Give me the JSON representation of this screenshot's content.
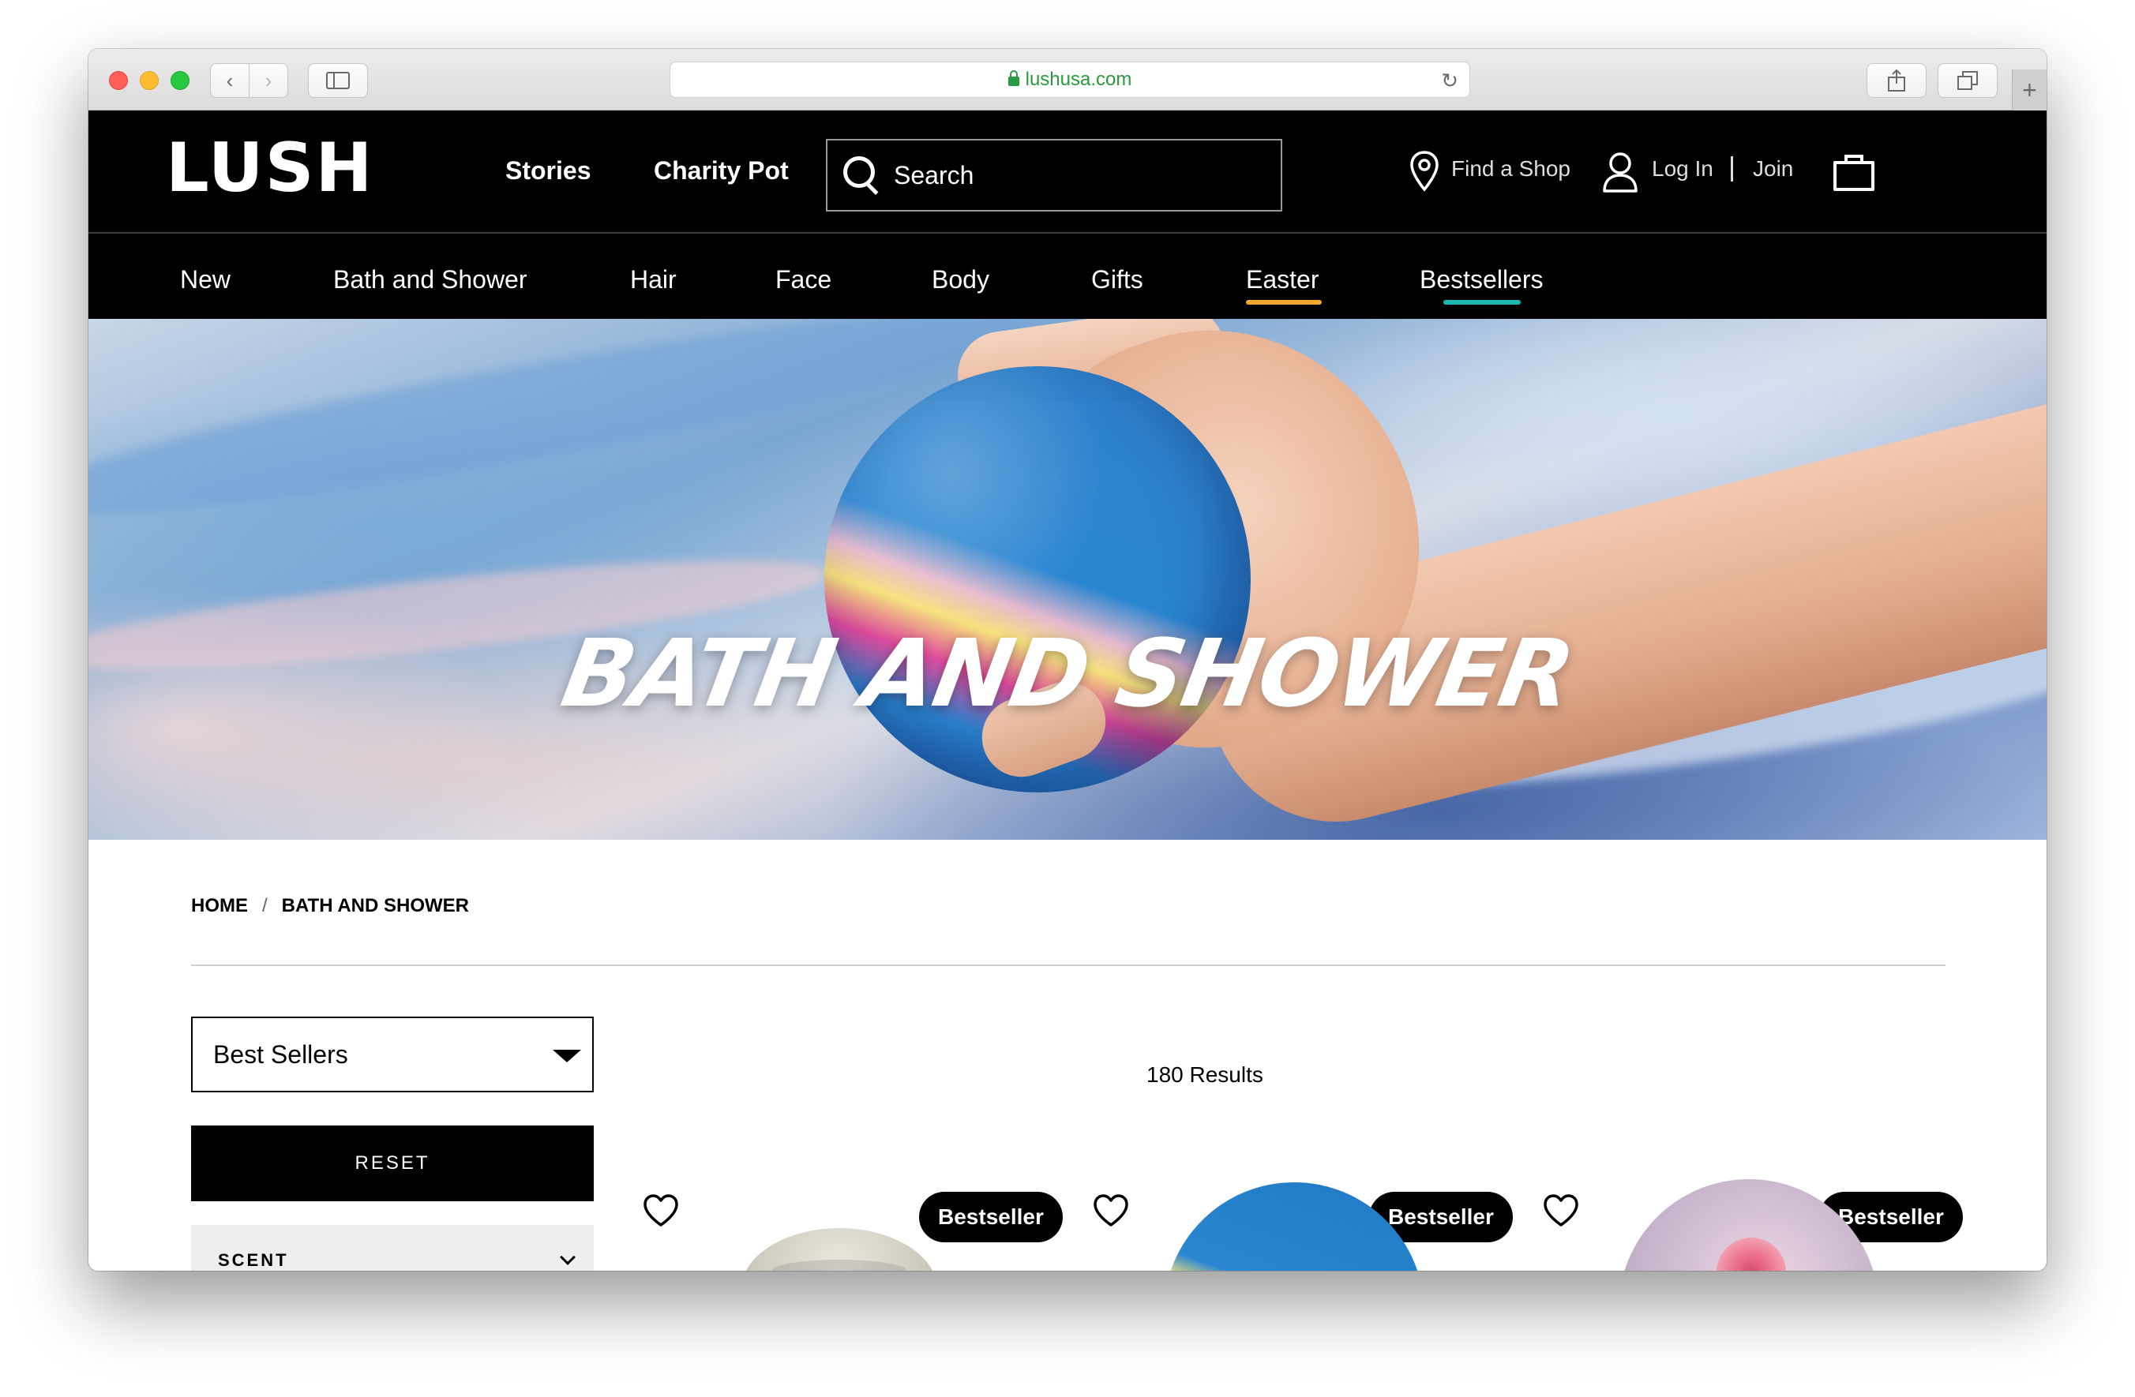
{
  "browser": {
    "url": "lushusa.com",
    "new_tab_symbol": "+"
  },
  "header": {
    "logo": "LUSH",
    "links": [
      "Stories",
      "Charity Pot"
    ],
    "search_placeholder": "Search",
    "find_shop": "Find a Shop",
    "log_in": "Log In",
    "join": "Join"
  },
  "category_nav": {
    "items": [
      "New",
      "Bath and Shower",
      "Hair",
      "Face",
      "Body",
      "Gifts",
      "Easter",
      "Bestsellers"
    ],
    "easter_underline_color": "#f0a92e",
    "bestsellers_underline_color": "#1fb5b0"
  },
  "hero": {
    "title": "BATH AND SHOWER"
  },
  "breadcrumb": {
    "home": "HOME",
    "separator": "/",
    "current": "BATH AND SHOWER"
  },
  "filters": {
    "sort_selected": "Best Sellers",
    "reset_label": "RESET",
    "scent_label": "SCENT"
  },
  "results": {
    "count_text": "180 Results"
  },
  "products": [
    {
      "badge": "Bestseller"
    },
    {
      "badge": "Bestseller"
    },
    {
      "badge": "Bestseller"
    }
  ],
  "colors": {
    "brand_black": "#000000",
    "secure_green": "#2a9a40"
  }
}
